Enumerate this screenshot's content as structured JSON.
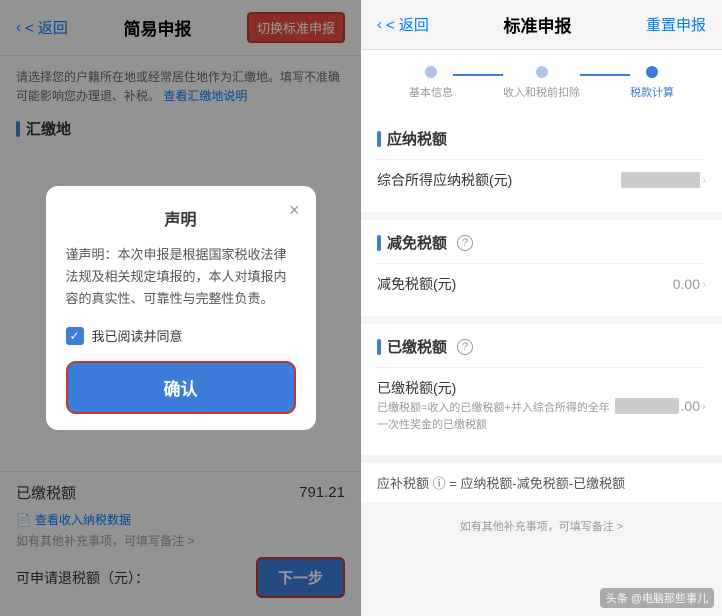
{
  "left": {
    "back_label": "< 返回",
    "title": "简易申报",
    "switch_btn_label": "切换标准申报",
    "info_text": "请选择您的户籍所在地或经常居住地作为汇缴地。填写不准确可能影响您办理退、补税。",
    "info_link_text": "查看汇缴地说明",
    "section_title": "汇缴地",
    "dialog": {
      "title": "声明",
      "close_icon": "×",
      "content": "谨声明：本次申报是根据国家税收法律法规及相关规定填报的，本人对填报内容的真实性、可靠性与完整性负责。",
      "checkbox_label": "我已阅读并同意",
      "confirm_btn_label": "确认"
    },
    "tax_paid_label": "已缴税额",
    "tax_paid_value": "791.21",
    "tax_link_text": "查看收入纳税数据",
    "note_link_text": "如有其他补充事项，可填写备注 >",
    "refund_label": "可申请退税额（元）：",
    "next_btn_label": "下一步"
  },
  "right": {
    "back_label": "< 返回",
    "title": "标准申报",
    "reset_btn_label": "重置申报",
    "steps": [
      {
        "label": "基本信息",
        "active": false
      },
      {
        "label": "收入和税前扣除",
        "active": false
      },
      {
        "label": "税款计算",
        "active": true
      }
    ],
    "sections": [
      {
        "title": "应纳税额",
        "rows": [
          {
            "label": "综合所得应纳税额(元)",
            "value": "",
            "blurred": true,
            "has_chevron": true
          }
        ]
      },
      {
        "title": "减免税额",
        "has_help": true,
        "rows": [
          {
            "label": "减免税额(元)",
            "value": "0.00",
            "has_chevron": true
          }
        ]
      },
      {
        "title": "已缴税额",
        "has_help": true,
        "rows": [
          {
            "label": "已缴税额(元)",
            "sub_text": "已缴税额=收入的已缴税额+并入综合所得的全年一次性奖金的已缴税额",
            "value": ".00",
            "blurred_prefix": true,
            "has_chevron": true
          }
        ]
      }
    ],
    "formula_text": "应补税额 ⓘ = 应纳税额-减免税额-已缴税额",
    "note_text": "如有其他补充事项，可填写备注 >",
    "watermark": "头条 @电脑那些事儿"
  }
}
